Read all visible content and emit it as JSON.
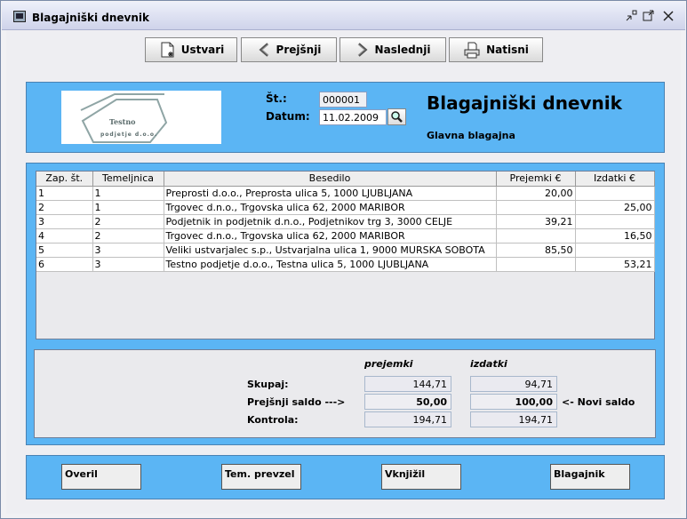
{
  "window": {
    "title": "Blagajniški dnevnik",
    "controls": [
      "minimize-icon",
      "maximize-icon",
      "close-icon"
    ]
  },
  "toolbar": {
    "create": "Ustvari",
    "previous": "Prejšnji",
    "next": "Naslednji",
    "print": "Natisni"
  },
  "header": {
    "logo_line1": "Testno",
    "logo_line2": "podjetje d.o.o.",
    "number_label": "Št.:",
    "number_value": "000001",
    "date_label": "Datum:",
    "date_value": "11.02.2009",
    "heading": "Blagajniški dnevnik",
    "subheading": "Glavna blagajna"
  },
  "table": {
    "columns": [
      "Zap. št.",
      "Temeljnica",
      "Besedilo",
      "Prejemki €",
      "Izdatki €"
    ],
    "rows": [
      [
        "1",
        "1",
        "Preprosti d.o.o., Preprosta ulica 5, 1000 LJUBLJANA",
        "20,00",
        ""
      ],
      [
        "2",
        "1",
        "Trgovec d.n.o., Trgovska ulica 62, 2000 MARIBOR",
        "",
        "25,00"
      ],
      [
        "3",
        "2",
        "Podjetnik in podjetnik d.n.o., Podjetnikov trg 3, 3000 CELJE",
        "39,21",
        ""
      ],
      [
        "4",
        "2",
        "Trgovec d.n.o., Trgovska ulica 62, 2000 MARIBOR",
        "",
        "16,50"
      ],
      [
        "5",
        "3",
        "Veliki ustvarjalec s.p., Ustvarjalna ulica 1, 9000 MURSKA SOBOTA",
        "85,50",
        ""
      ],
      [
        "6",
        "3",
        "Testno podjetje d.o.o., Testna ulica 5, 1000 LJUBLJANA",
        "",
        "53,21"
      ]
    ]
  },
  "summary": {
    "col_receipts": "prejemki",
    "col_expenses": "izdatki",
    "total_label": "Skupaj:",
    "previous_balance_label": "Prejšnji saldo --->",
    "control_label": "Kontrola:",
    "total_receipts": "144,71",
    "total_expenses": "94,71",
    "previous_receipts": "50,00",
    "previous_expenses": "100,00",
    "new_balance_label": "<- Novi saldo",
    "control_receipts": "194,71",
    "control_expenses": "194,71"
  },
  "footer": {
    "verified": "Overil",
    "tem_taken": "Tem. prevzel",
    "posted": "Vknjižil",
    "cashier": "Blagajnik"
  },
  "colors": {
    "panel": "#5bb5f4",
    "titlebar": "#cfd3ea"
  }
}
